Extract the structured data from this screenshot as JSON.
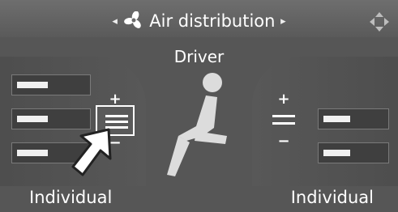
{
  "header": {
    "title": "Air distribution",
    "prev_arrow": "◂",
    "next_arrow": "▸",
    "fan_icon": "fan-icon",
    "nav_icon": "four-way-nav-icon"
  },
  "center": {
    "label": "Driver"
  },
  "left_zone": {
    "label": "Individual",
    "plus": "+",
    "minus": "−",
    "levels": [
      0.45,
      0.45,
      0.45
    ]
  },
  "right_zone": {
    "label": "Individual",
    "plus": "+",
    "minus": "−",
    "levels": [
      0.45,
      0.45
    ]
  }
}
